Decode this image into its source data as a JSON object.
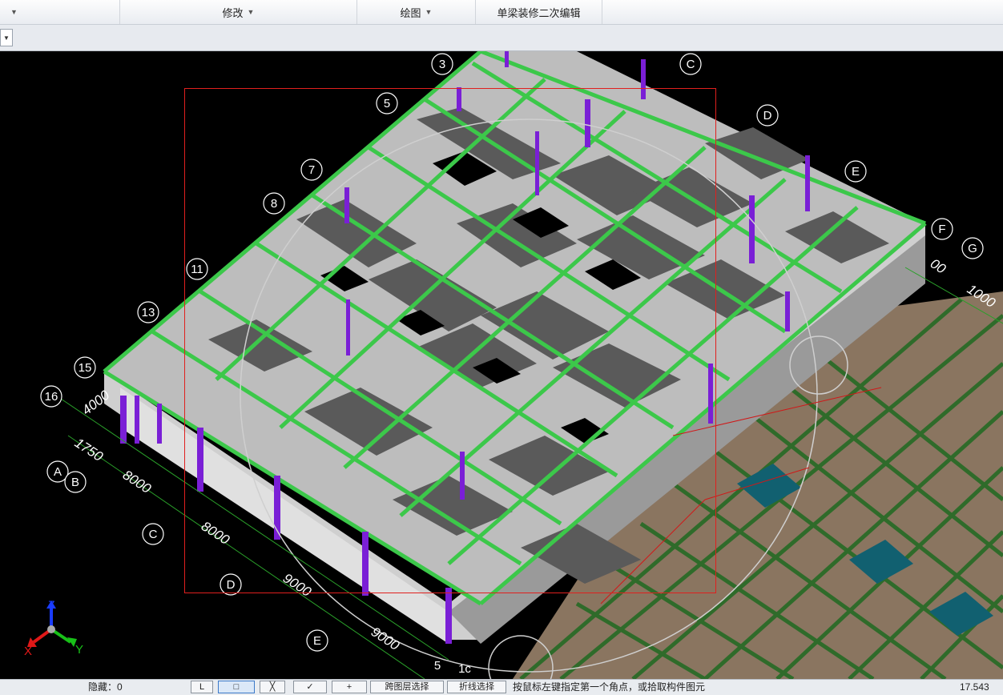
{
  "ribbon": {
    "left_arrow": "▼",
    "sections": [
      {
        "label": "修改",
        "has_arrow": true
      },
      {
        "label": "绘图",
        "has_arrow": true
      },
      {
        "label": "单梁装修二次编辑",
        "has_arrow": false
      }
    ]
  },
  "toolbar": {
    "combo_arrow": "▼"
  },
  "grid_axes": {
    "numbered": [
      "3",
      "5",
      "7",
      "8",
      "11",
      "13",
      "15",
      "16"
    ],
    "lettered_top": [
      "C",
      "D",
      "E",
      "F",
      "G"
    ],
    "lettered_left": [
      "A",
      "B",
      "C",
      "D",
      "E"
    ],
    "bottom_partial": [
      "5",
      "1c"
    ]
  },
  "dimensions": {
    "left_side": [
      "4000",
      "1750",
      "8000",
      "8000",
      "9000",
      "9000"
    ],
    "right_side": [
      "00",
      "1000"
    ]
  },
  "coord_triad": {
    "x": "X",
    "y": "Y",
    "z": "Z"
  },
  "statusbar": {
    "layer_label": "隐藏：0",
    "mode_buttons": [
      "L",
      "□",
      "╳",
      "✓",
      "+"
    ],
    "btn_fence_select": "跨图层选择",
    "btn_polyline_select": "折线选择",
    "hint": "按鼠标左键指定第一个角点，或拾取构件图元",
    "coord": "17.543"
  },
  "colors": {
    "beam_green": "#3cc84a",
    "column_purple": "#7a1fd6",
    "slab_gray": "#5a5a5a",
    "wall_light": "#d6d6d6",
    "selection_red": "#e0201e",
    "foundation_brown": "#8a7560",
    "viewport_bg": "#000000"
  }
}
